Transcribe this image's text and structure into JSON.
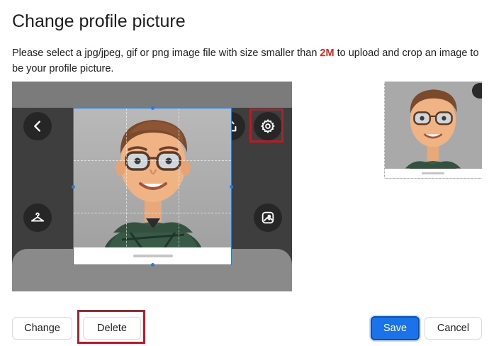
{
  "dialog": {
    "title": "Change profile picture",
    "description_before": "Please select a jpg/jpeg, gif or png image file with size smaller than ",
    "description_size": "2M",
    "description_after": " to upload and crop an image to be your profile picture."
  },
  "cropper": {
    "icons": [
      "back-icon",
      "share-icon",
      "gear-icon",
      "hanger-icon",
      "sticker-icon"
    ]
  },
  "buttons": {
    "change": "Change",
    "delete": "Delete",
    "save": "Save",
    "cancel": "Cancel"
  },
  "colors": {
    "accent": "#1a73e8",
    "highlight": "#b21f2b",
    "size_text": "#e0241b"
  }
}
